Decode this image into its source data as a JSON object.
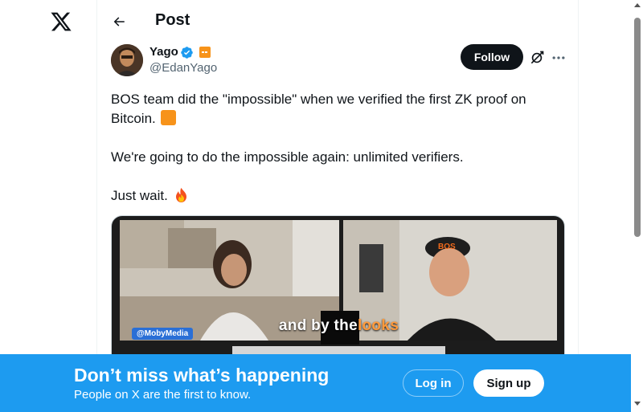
{
  "header": {
    "title": "Post"
  },
  "author": {
    "name": "Yago",
    "handle": "@EdanYago",
    "verified": true
  },
  "actions": {
    "follow_label": "Follow"
  },
  "tweet": {
    "line1": "BOS team did the \"impossible\" when we verified the first ZK proof on Bitcoin.",
    "line2": "We're going to do the impossible again: unlimited verifiers.",
    "line3": "Just wait."
  },
  "media": {
    "caption_before": "and by the",
    "caption_highlight": "looks",
    "watermark": "@MobyMedia"
  },
  "signup_bar": {
    "title": "Don’t miss what’s happening",
    "subtitle": "People on X are the first to know.",
    "login_label": "Log in",
    "signup_label": "Sign up"
  },
  "colors": {
    "accent": "#1d9bf0",
    "text": "#0f1419",
    "secondary": "#536471",
    "bitcoin_orange": "#f7931a"
  },
  "icons": [
    "x-logo-icon",
    "back-arrow-icon",
    "verified-badge-icon",
    "affiliate-badge-icon",
    "grok-icon",
    "more-icon",
    "orange-square-emoji",
    "fire-emoji"
  ]
}
